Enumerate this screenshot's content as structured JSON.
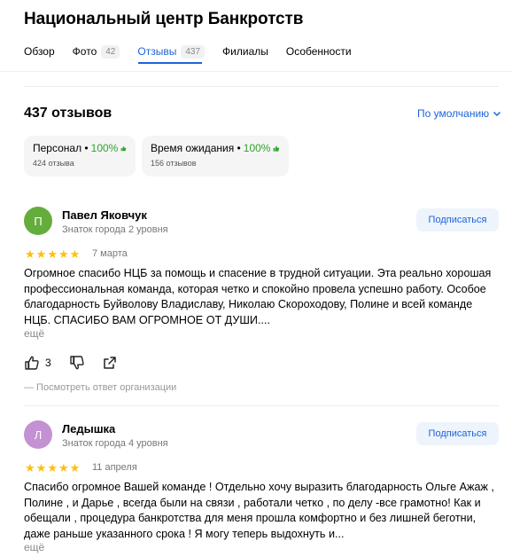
{
  "title": "Национальный центр Банкротств",
  "tabs": [
    {
      "label": "Обзор"
    },
    {
      "label": "Фото",
      "count": "42"
    },
    {
      "label": "Отзывы",
      "count": "437"
    },
    {
      "label": "Филиалы"
    },
    {
      "label": "Особенности"
    }
  ],
  "summary": {
    "count_label": "437 отзывов",
    "sort_label": "По умолчанию"
  },
  "aspects": [
    {
      "name": "Персонал",
      "percent": "100%",
      "sub": "424 отзыва"
    },
    {
      "name": "Время ожидания",
      "percent": "100%",
      "sub": "156 отзывов"
    }
  ],
  "reviews": [
    {
      "initial": "П",
      "avatar_color": "#64ad3c",
      "author": "Павел Яковчук",
      "level": "Знаток города 2 уровня",
      "subscribe": "Подписаться",
      "rating": 5,
      "date": "7 марта",
      "text": "Огромное спасибо НЦБ за помощь и спасение в трудной ситуации. Эта реально хорошая профессиональная команда, которая четко и спокойно провела успешно работу. Особое благодарность Буйволову Владиславу, Николаю Скороходову, Полине и всей команде НЦБ. СПАСИБО ВАМ ОГРОМНОЕ ОТ ДУШИ....",
      "more": "ещё",
      "likes": "3",
      "org_answer": "— Посмотреть ответ организации"
    },
    {
      "initial": "Л",
      "avatar_color": "#c491d2",
      "author": "Ледышка",
      "level": "Знаток города 4 уровня",
      "subscribe": "Подписаться",
      "rating": 5,
      "date": "11 апреля",
      "text": "Спасибо огромное Вашей команде ! Отдельно хочу выразить благодарность Ольге Ажаж , Полине , и Дарье , всегда были на связи , работали четко , по делу -все грамотно! Как и обещали , процедура банкротства для меня прошла комфортно и без лишней беготни, даже раньше указанного срока ! Я могу теперь выдохнуть и...",
      "more": "ещё"
    }
  ],
  "colors": {
    "accent": "#1e63d9",
    "positive": "#2da52d",
    "star": "#fdc00a"
  }
}
